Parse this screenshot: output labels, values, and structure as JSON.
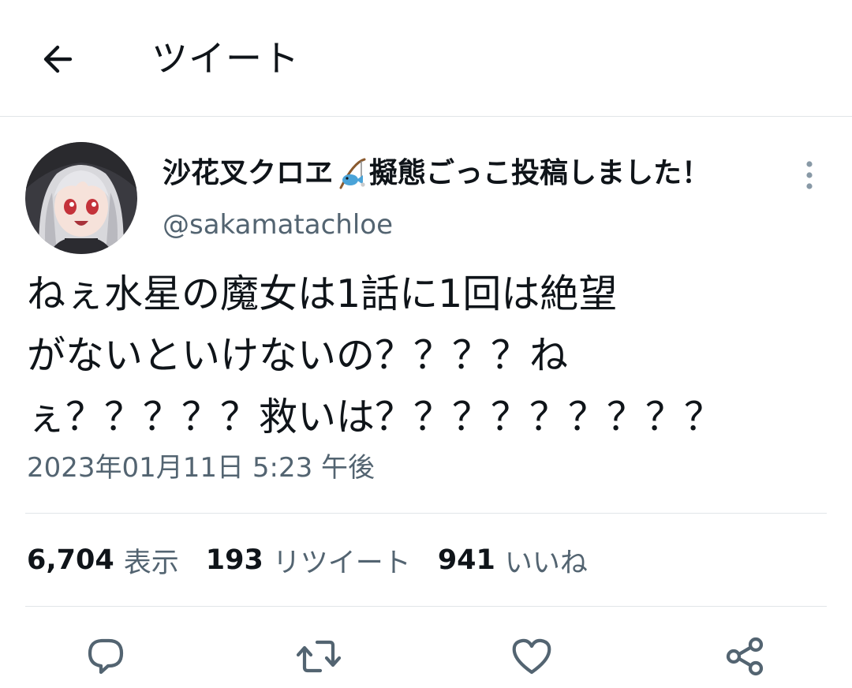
{
  "header": {
    "title": "ツイート"
  },
  "tweet": {
    "display_name_part1": "沙花叉クロヱ",
    "display_name_part2": "擬態ごっこ投稿しました！",
    "name_emoji": "fishing-pole-icon",
    "handle": "@sakamatachloe",
    "text_lines": [
      "ねぇ水星の魔女は1話に1回は絶望",
      "がないといけないの？？？？ね",
      "ぇ？？？？？救いは？？？？？？？？？"
    ],
    "timestamp": "2023年01月11日 5:23 午後"
  },
  "stats": {
    "views_count": "6,704",
    "views_label": "表示",
    "retweets_count": "193",
    "retweets_label": "リツイート",
    "likes_count": "941",
    "likes_label": "いいね"
  },
  "icons": {
    "back": "arrow-left-icon",
    "more": "more-vertical-icon",
    "reply": "reply-icon",
    "retweet": "retweet-icon",
    "like": "heart-icon",
    "share": "share-icon"
  },
  "colors": {
    "text_primary": "#0f1419",
    "text_secondary": "#536471",
    "divider": "#e1e5e8",
    "icon": "#536471"
  }
}
